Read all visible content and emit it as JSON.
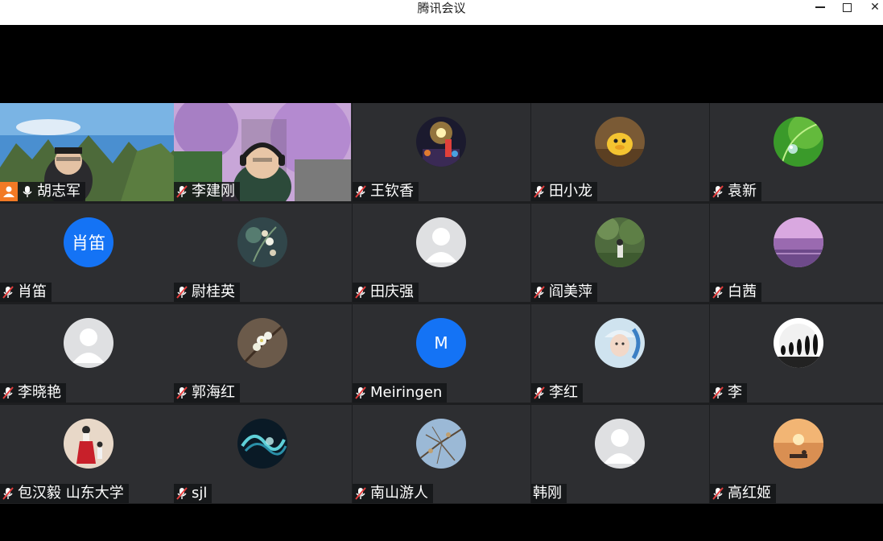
{
  "window": {
    "title": "腾讯会议",
    "minimize_icon": "minimize-icon",
    "maximize_icon": "maximize-icon",
    "close_icon": "close-icon",
    "close_glyph": "✕"
  },
  "colors": {
    "active_border": "#2fb35a",
    "host_badge": "#f27a25",
    "letter_avatar": "#1473f5",
    "tile_bg": "#2d2e31"
  },
  "participants": [
    {
      "name": "胡志军",
      "video": true,
      "host": true,
      "muted": false
    },
    {
      "name": "李建刚",
      "video": true,
      "host": false,
      "muted": true
    },
    {
      "name": "王钦香",
      "avatar": "fireworks",
      "muted": true
    },
    {
      "name": "田小龙",
      "avatar": "cartoon-duck",
      "muted": true
    },
    {
      "name": "袁新",
      "avatar": "green-leaf",
      "muted": true
    },
    {
      "name": "肖笛",
      "avatar_text": "肖笛",
      "muted": true
    },
    {
      "name": "尉桂英",
      "avatar": "flower-art",
      "muted": true
    },
    {
      "name": "田庆强",
      "avatar": "default-person",
      "muted": true
    },
    {
      "name": "阎美萍",
      "avatar": "forest-girl",
      "muted": true
    },
    {
      "name": "白茜",
      "avatar": "purple-lake",
      "muted": true
    },
    {
      "name": "李晓艳",
      "avatar": "default-person",
      "muted": true
    },
    {
      "name": "郭海红",
      "avatar": "white-blossom",
      "muted": true
    },
    {
      "name": "Meiringen",
      "avatar_text": "M",
      "muted": true
    },
    {
      "name": "李红",
      "avatar": "girl-cap",
      "muted": true
    },
    {
      "name": "李",
      "avatar": "evolution",
      "muted": true
    },
    {
      "name": "包汉毅 山东大学",
      "avatar": "red-dress",
      "muted": true
    },
    {
      "name": "sjl",
      "avatar": "teal-swirl",
      "muted": true
    },
    {
      "name": "南山游人",
      "avatar": "branches-sky",
      "muted": true
    },
    {
      "name": "韩刚",
      "avatar": "default-person",
      "muted": false,
      "no_mic": true
    },
    {
      "name": "高红姬",
      "avatar": "sunset-beach",
      "muted": true
    }
  ]
}
